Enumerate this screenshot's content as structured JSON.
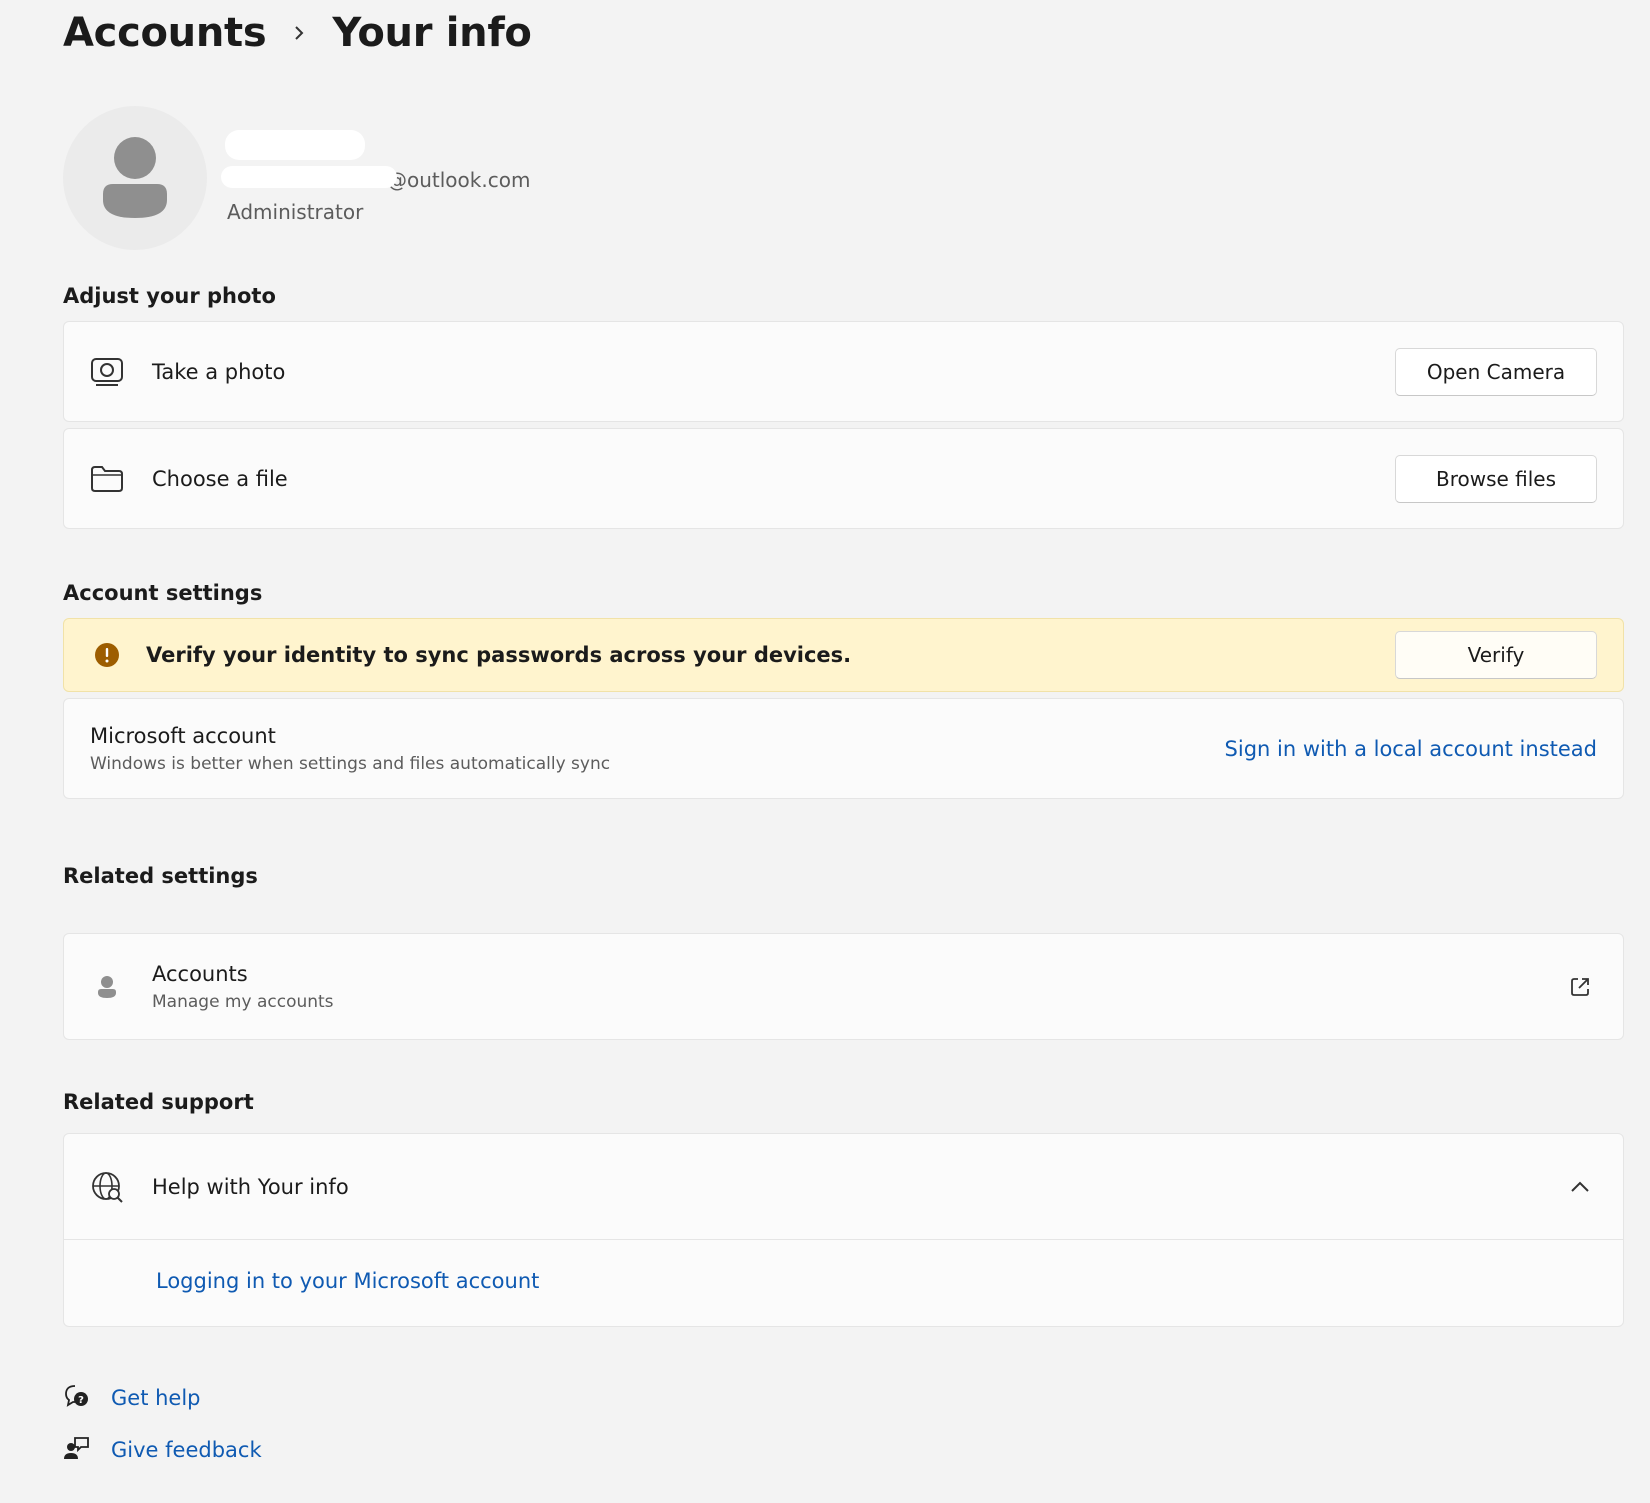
{
  "breadcrumb": {
    "parent": "Accounts",
    "current": "Your info"
  },
  "profile": {
    "email_suffix": "@outlook.com",
    "role": "Administrator"
  },
  "adjust_photo": {
    "title": "Adjust your photo",
    "take_photo": {
      "label": "Take a photo",
      "button": "Open Camera"
    },
    "choose_file": {
      "label": "Choose a file",
      "button": "Browse files"
    }
  },
  "account_settings": {
    "title": "Account settings",
    "warning": {
      "text": "Verify your identity to sync passwords across your devices.",
      "button": "Verify"
    },
    "microsoft_account": {
      "title": "Microsoft account",
      "subtitle": "Windows is better when settings and files automatically sync",
      "link": "Sign in with a local account instead"
    }
  },
  "related_settings": {
    "title": "Related settings",
    "accounts": {
      "title": "Accounts",
      "subtitle": "Manage my accounts"
    }
  },
  "related_support": {
    "title": "Related support",
    "help": {
      "label": "Help with Your info",
      "link": "Logging in to your Microsoft account"
    }
  },
  "footer": {
    "get_help": "Get help",
    "give_feedback": "Give feedback"
  },
  "colors": {
    "accent": "#0f5ab2",
    "warning_bg": "#fff4ce",
    "warning_icon": "#9d5d00",
    "background": "#f3f3f3"
  },
  "icons": [
    "chevron-right-icon",
    "person-icon",
    "camera-icon",
    "folder-icon",
    "warning-icon",
    "external-link-icon",
    "globe-search-icon",
    "chevron-up-icon",
    "help-chat-icon",
    "feedback-icon"
  ]
}
